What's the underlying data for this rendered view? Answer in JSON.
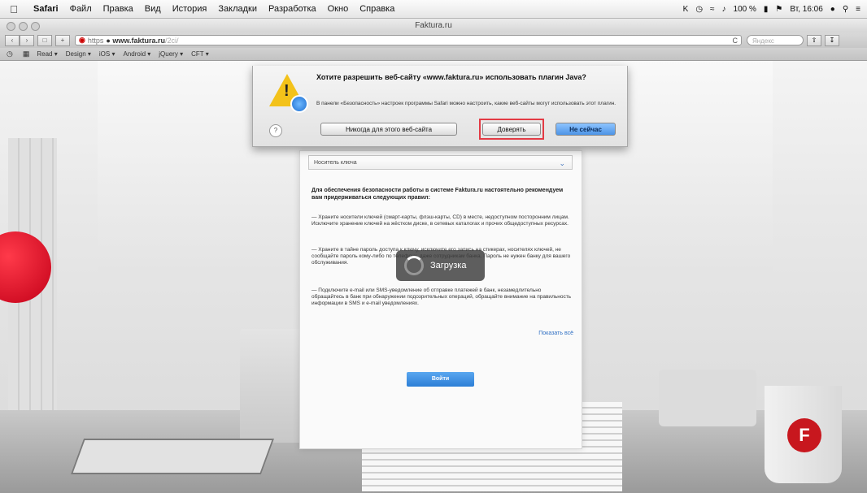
{
  "menubar": {
    "apple": "",
    "items": [
      "Safari",
      "Файл",
      "Правка",
      "Вид",
      "История",
      "Закладки",
      "Разработка",
      "Окно",
      "Справка"
    ],
    "status": {
      "battery": "100 %",
      "clock": "Вт, 16:06"
    }
  },
  "window": {
    "title": "Faktura.ru"
  },
  "toolbar": {
    "back": "‹",
    "forward": "›",
    "url_https": "https",
    "url_host": "www.faktura.ru",
    "url_path": "/2ci/",
    "reload": "C",
    "search_placeholder": "Яндекс"
  },
  "bookmarks": {
    "items": [
      "Read ▾",
      "Design ▾",
      "iOS ▾",
      "Android ▾",
      "jQuery ▾",
      "CFT ▾"
    ]
  },
  "dialog": {
    "title": "Хотите разрешить веб-сайту «www.faktura.ru» использовать плагин Java?",
    "text": "В панели «Безопасность» настроек программы Safari можно настроить, какие веб-сайты могут использовать этот плагин.",
    "help": "?",
    "never_label": "Никогда для этого веб-сайта",
    "trust_label": "Доверять",
    "notnow_label": "Не сейчас"
  },
  "card": {
    "select_value": "Носитель ключа",
    "heading": "Для обеспечения безопасности работы в системе Faktura.ru настоятельно рекомендуем вам придерживаться следующих правил:",
    "para1": "— Храните носители ключей (смарт-карты, флэш-карты, CD) в месте, недоступном посторонним лицам. Исключите хранение ключей на жёстком диске, в сетевых каталогах и прочих общедоступных ресурсах.",
    "para2": "— Храните в тайне пароль доступа к ключу, исключите его запись на стикерах, носителях ключей, не сообщайте пароль кому-либо по телефону, даже сотрудникам банка. Пароль не нужен банку для вашего обслуживания.",
    "para3": "— Подключите e-mail или SMS-уведомление об отправке платежей в банк, незамедлительно обращайтесь в банк при обнаружении подозрительных операций, обращайте внимание на правильность информации в SMS и e-mail уведомлениях.",
    "show_all": "Показать всё",
    "login_label": "Войти"
  },
  "loading": {
    "label": "Загрузка"
  },
  "colors": {
    "accent": "#2c7ed6",
    "warning": "#f3c21a",
    "highlight": "#e33a44",
    "brand": "#c8171e"
  },
  "mug": {
    "logo": "F"
  }
}
